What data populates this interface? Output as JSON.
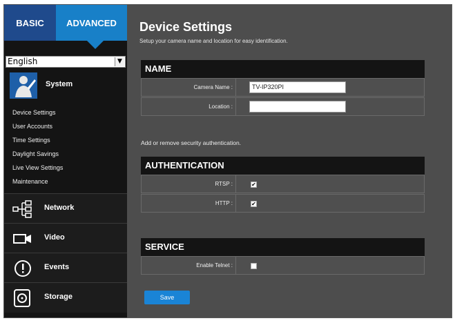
{
  "tabs": {
    "basic": "BASIC",
    "advanced": "ADVANCED"
  },
  "language": {
    "selected": "English"
  },
  "system": {
    "label": "System",
    "items": [
      "Device Settings",
      "User Accounts",
      "Time Settings",
      "Daylight Savings",
      "Live View Settings",
      "Maintenance"
    ]
  },
  "nav": [
    {
      "label": "Network",
      "icon": "network-icon"
    },
    {
      "label": "Video",
      "icon": "video-camera-icon"
    },
    {
      "label": "Events",
      "icon": "alert-icon"
    },
    {
      "label": "Storage",
      "icon": "storage-disk-icon"
    }
  ],
  "page": {
    "title": "Device Settings",
    "subtitle": "Setup your camera name and location for easy identification."
  },
  "name_section": {
    "header": "NAME",
    "camera_name_label": "Camera Name :",
    "camera_name_value": "TV-IP320PI",
    "location_label": "Location :",
    "location_value": ""
  },
  "auth_note": "Add or remove security authentication.",
  "auth_section": {
    "header": "AUTHENTICATION",
    "rtsp_label": "RTSP :",
    "rtsp_checked": "✔",
    "http_label": "HTTP :",
    "http_checked": "✔"
  },
  "service_section": {
    "header": "SERVICE",
    "telnet_label": "Enable Telnet :",
    "telnet_checked": ""
  },
  "save_label": "Save",
  "colors": {
    "accent": "#1880c8",
    "sidebar": "#141414",
    "content": "#4d4d4d"
  }
}
